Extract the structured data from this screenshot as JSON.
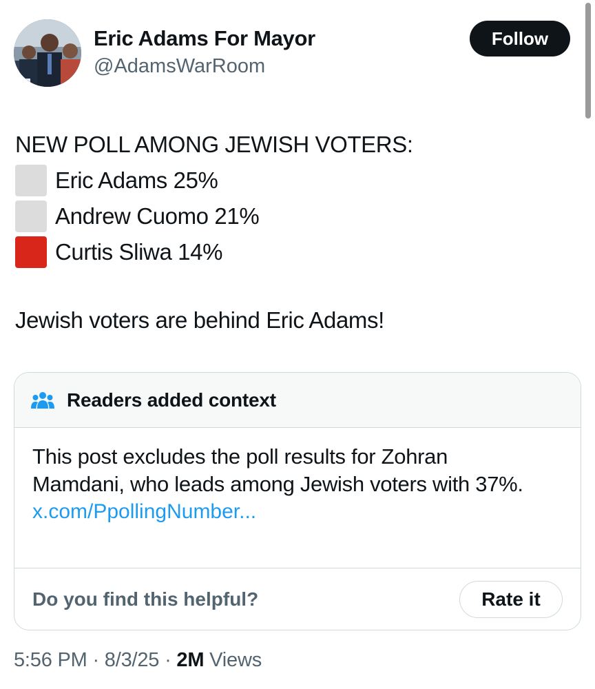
{
  "colors": {
    "text": "#0f1419",
    "secondary": "#536471",
    "link": "#1d9bf0",
    "follow_bg": "#0f1419",
    "border": "#cfd9de",
    "card_header_bg": "#f7f9f9",
    "white_square": "#dcdcdc",
    "red_square": "#d8261b"
  },
  "author": {
    "name": "Eric Adams For Mayor",
    "handle": "@AdamsWarRoom",
    "avatar": "avatar-photo"
  },
  "follow_button": {
    "label": "Follow"
  },
  "post": {
    "headline": "NEW POLL AMONG JEWISH VOTERS:",
    "poll": [
      {
        "icon": "white-square-icon",
        "text": "Eric Adams 25%"
      },
      {
        "icon": "white-square-icon",
        "text": "Andrew Cuomo 21%"
      },
      {
        "icon": "red-square-icon",
        "text": "Curtis Sliwa 14%"
      }
    ],
    "closing": "Jewish voters are behind Eric Adams!"
  },
  "context_note": {
    "icon": "people-icon",
    "title": "Readers added context",
    "text": "This post excludes the poll results for Zohran Mamdani, who leads among Jewish voters with 37%.",
    "link": "x.com/PpollingNumber...",
    "question": "Do you find this helpful?",
    "rate_label": "Rate it"
  },
  "meta": {
    "time": "5:56 PM",
    "separator": "·",
    "date": "8/3/25",
    "views_count": "2M",
    "views_label": "Views"
  }
}
